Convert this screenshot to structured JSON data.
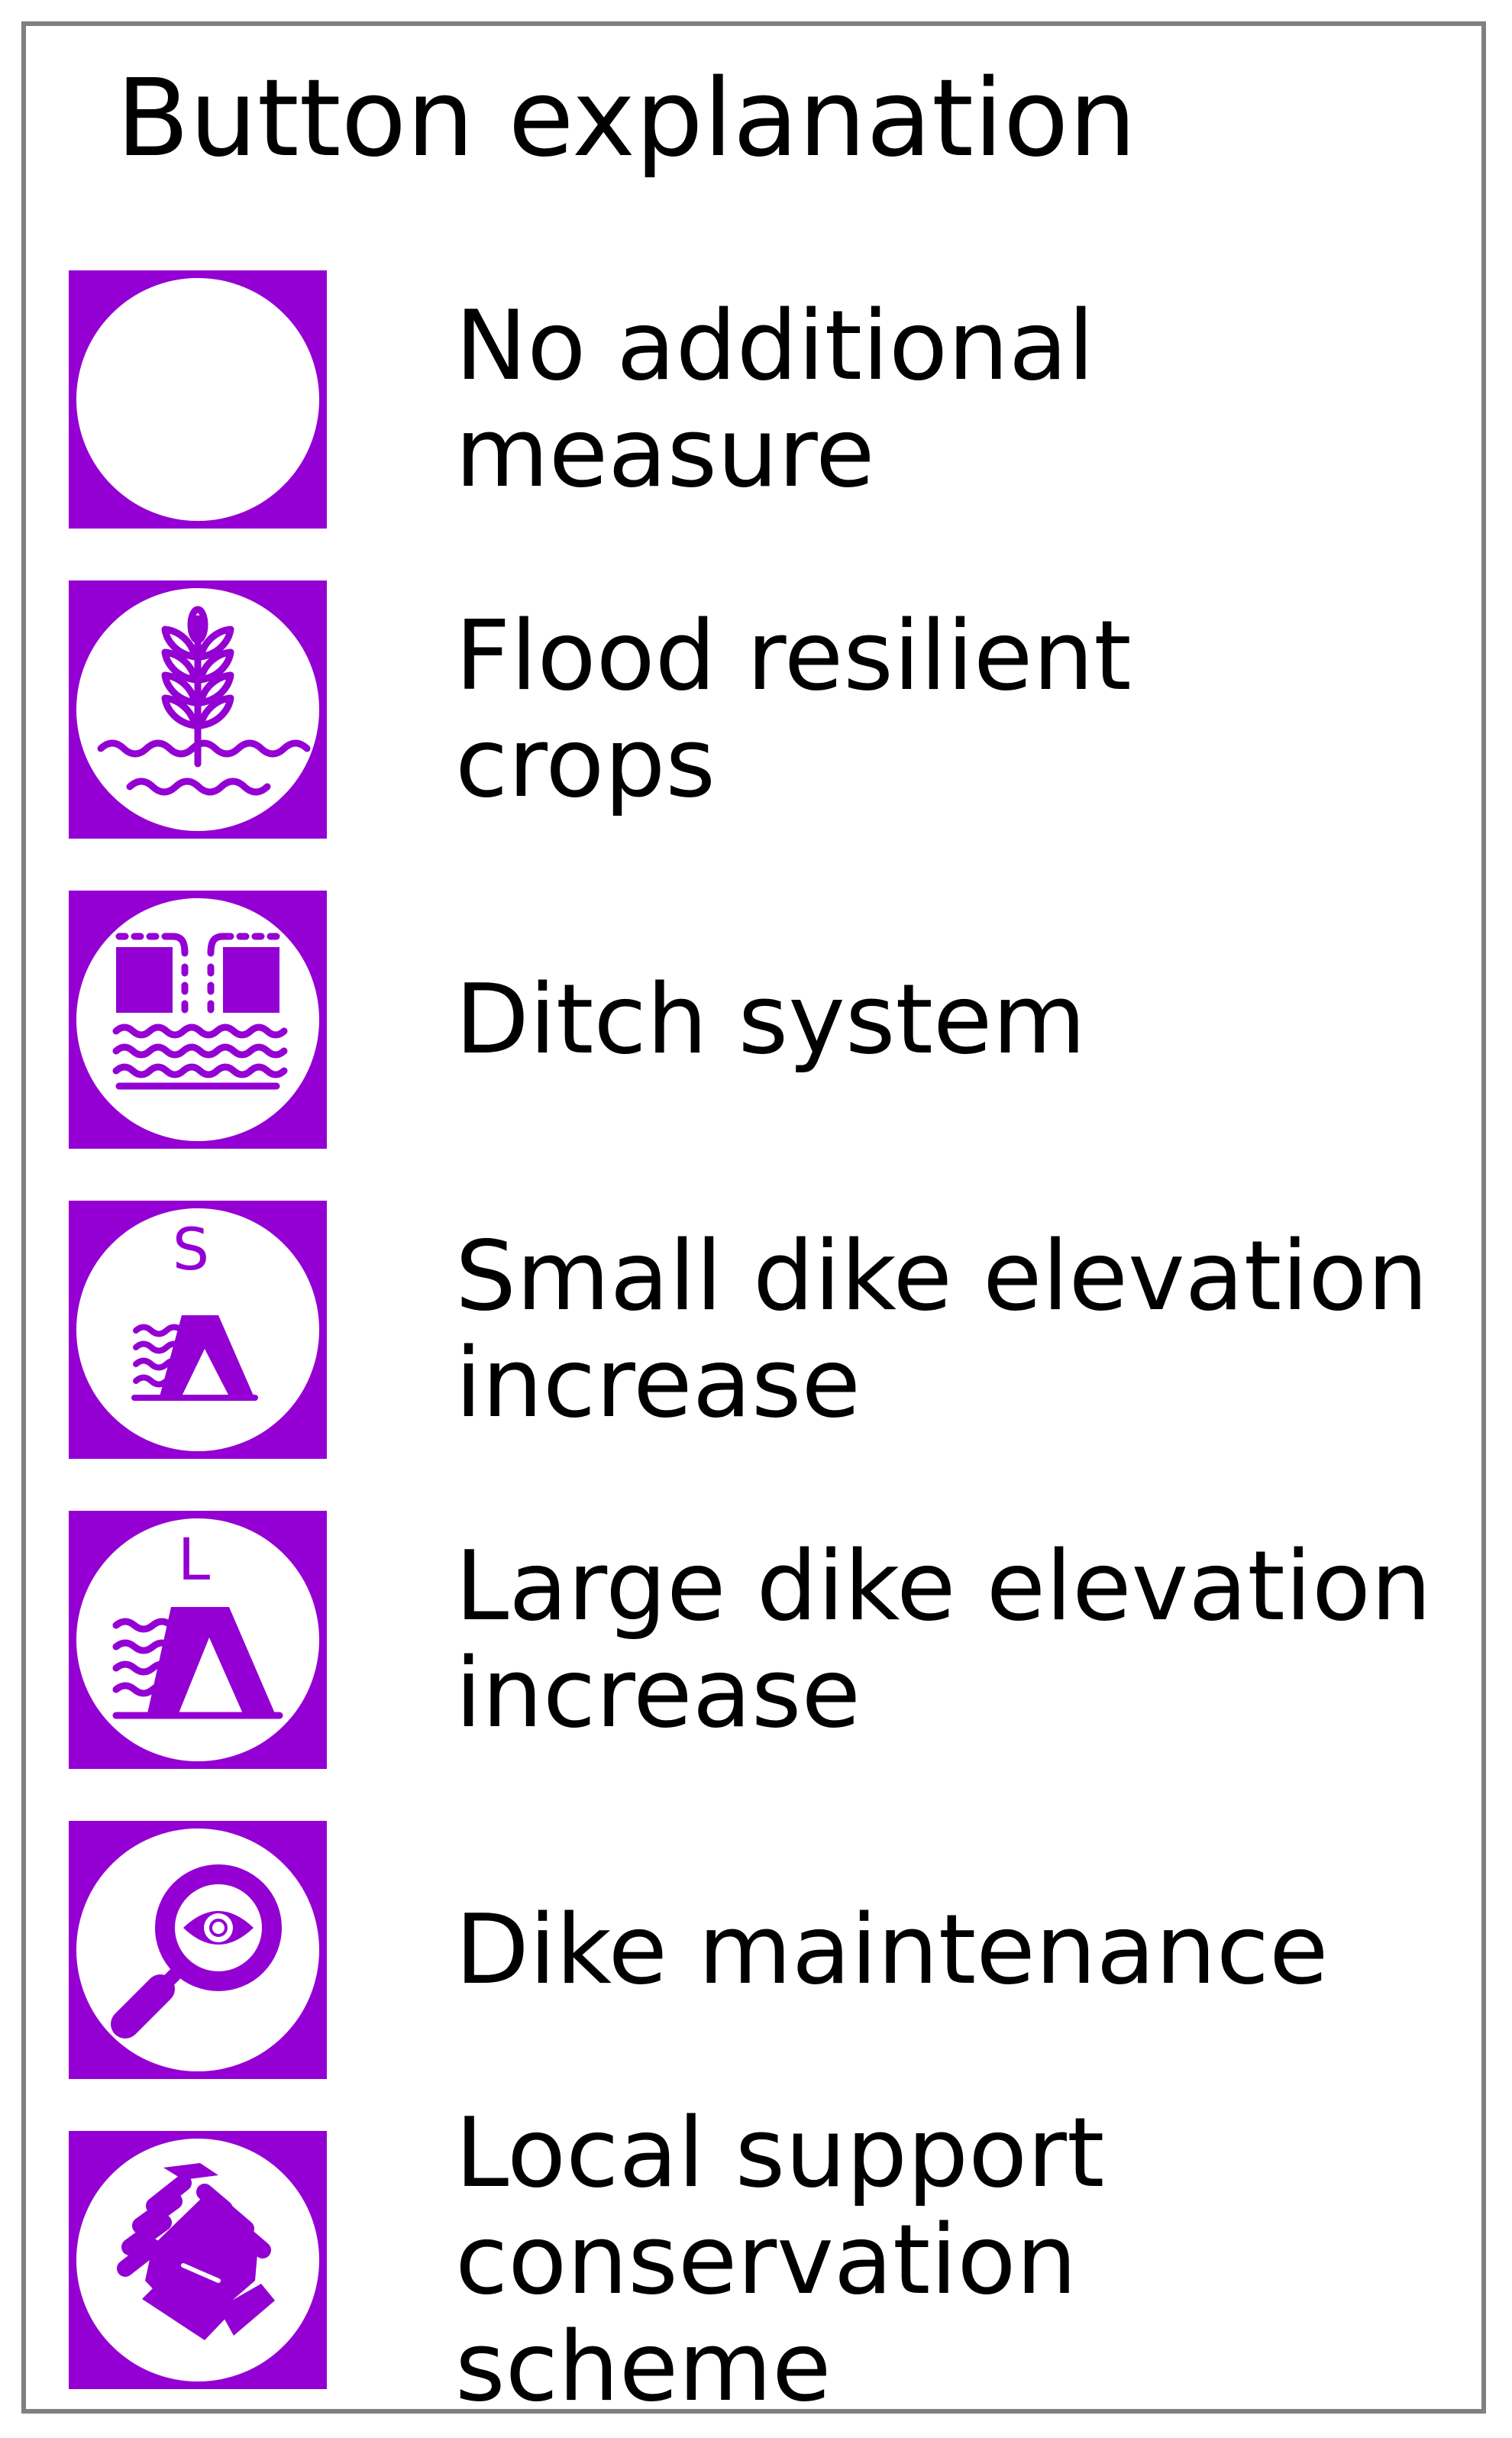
{
  "title": "Button explanation",
  "colors": {
    "button_fill": "#9400d3",
    "icon_background": "#ffffff",
    "frame_border": "#808080"
  },
  "legend": [
    {
      "icon": "blank-circle-icon",
      "label": "No additional\nmeasure"
    },
    {
      "icon": "wheat-water-icon",
      "label": "Flood resilient\ncrops"
    },
    {
      "icon": "ditch-system-icon",
      "label": "Ditch system"
    },
    {
      "icon": "small-dike-icon",
      "icon_letter": "S",
      "label": "Small dike elevation\nincrease"
    },
    {
      "icon": "large-dike-icon",
      "icon_letter": "L",
      "label": "Large dike elevation\nincrease"
    },
    {
      "icon": "magnifier-eye-icon",
      "label": "Dike maintenance"
    },
    {
      "icon": "handshake-icon",
      "label": "Local support\nconservation scheme"
    }
  ]
}
